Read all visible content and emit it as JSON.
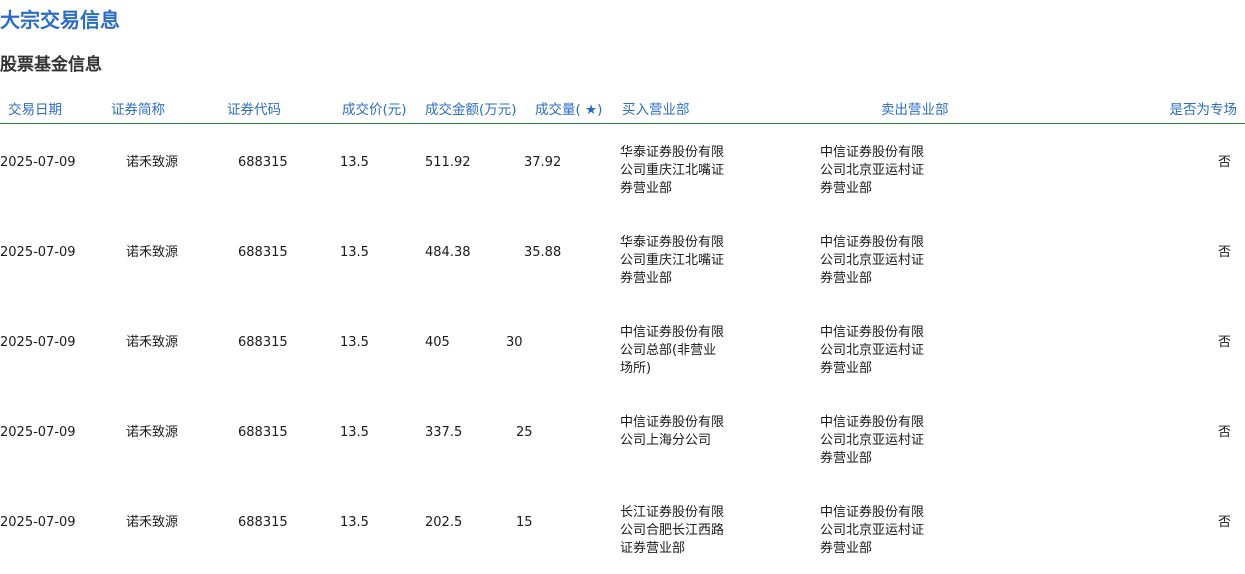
{
  "page_title": "大宗交易信息",
  "section_title": "股票基金信息",
  "table": {
    "headers": {
      "date": "交易日期",
      "name": "证券简称",
      "code": "证券代码",
      "price": "成交价(元)",
      "amount": "成交金额(万元)",
      "volume": "成交量( ★)",
      "buy": "买入营业部",
      "sell": "卖出营业部",
      "flag": "是否为专场"
    },
    "rows": [
      {
        "date": "2025-07-09",
        "name": "诺禾致源",
        "code": "688315",
        "price": "13.5",
        "amount": "511.92",
        "volume": "37.92",
        "buy": "华泰证券股份有限公司重庆江北嘴证券营业部",
        "sell": "中信证券股份有限公司北京亚运村证券营业部",
        "flag": "否"
      },
      {
        "date": "2025-07-09",
        "name": "诺禾致源",
        "code": "688315",
        "price": "13.5",
        "amount": "484.38",
        "volume": "35.88",
        "buy": "华泰证券股份有限公司重庆江北嘴证券营业部",
        "sell": "中信证券股份有限公司北京亚运村证券营业部",
        "flag": "否"
      },
      {
        "date": "2025-07-09",
        "name": "诺禾致源",
        "code": "688315",
        "price": "13.5",
        "amount": "405",
        "volume": "30",
        "buy": "中信证券股份有限公司总部(非营业场所)",
        "sell": "中信证券股份有限公司北京亚运村证券营业部",
        "flag": "否"
      },
      {
        "date": "2025-07-09",
        "name": "诺禾致源",
        "code": "688315",
        "price": "13.5",
        "amount": "337.5",
        "volume": "25",
        "buy": "中信证券股份有限公司上海分公司",
        "sell": "中信证券股份有限公司北京亚运村证券营业部",
        "flag": "否"
      },
      {
        "date": "2025-07-09",
        "name": "诺禾致源",
        "code": "688315",
        "price": "13.5",
        "amount": "202.5",
        "volume": "15",
        "buy": "长江证券股份有限公司合肥长江西路证券营业部",
        "sell": "中信证券股份有限公司北京亚运村证券营业部",
        "flag": "否"
      }
    ]
  },
  "colors": {
    "title": "#2b6cc4",
    "header_text": "#2b6cc4",
    "header_rule": "#2d7a3c",
    "body_text": "#1a1a1a"
  }
}
